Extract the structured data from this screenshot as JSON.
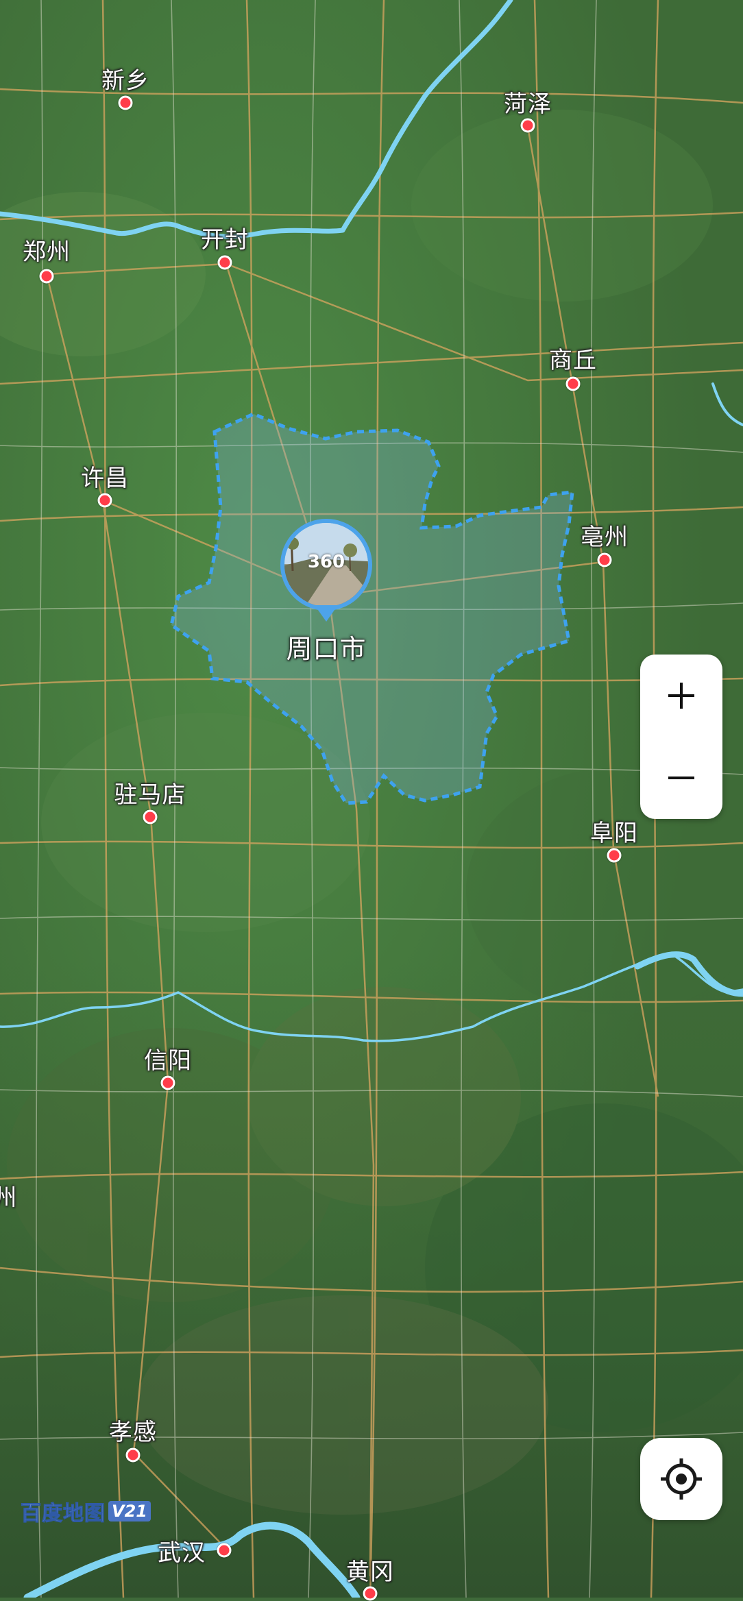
{
  "map": {
    "provider_logo": "百度地图",
    "provider_version": "V21",
    "colors": {
      "river": "#7fd3f2",
      "boundary": "#3ea2ef",
      "road": "#d8a560",
      "city_dot": "#ff3d4a",
      "control_bg": "#ffffff"
    },
    "highlighted_region": {
      "name": "周口市",
      "panorama_badge": "360"
    },
    "cities": [
      {
        "name": "新乡"
      },
      {
        "name": "菏泽"
      },
      {
        "name": "郑州"
      },
      {
        "name": "开封"
      },
      {
        "name": "商丘"
      },
      {
        "name": "许昌"
      },
      {
        "name": "亳州"
      },
      {
        "name": "驻马店"
      },
      {
        "name": "阜阳"
      },
      {
        "name": "信阳"
      },
      {
        "name": "孝感"
      },
      {
        "name": "武汉"
      },
      {
        "name": "黄冈"
      }
    ],
    "edge_label_partial": "州"
  },
  "controls": {
    "zoom_in": {
      "label": "+",
      "icon": "plus-icon"
    },
    "zoom_out": {
      "label": "−",
      "icon": "minus-icon"
    },
    "locate": {
      "icon": "locate-crosshair-icon"
    }
  }
}
